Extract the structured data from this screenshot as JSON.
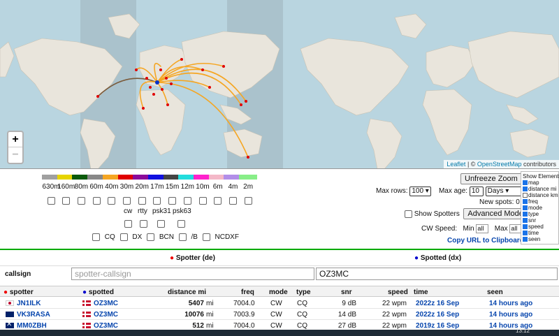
{
  "map": {
    "zoom_in": "+",
    "zoom_out": "−",
    "attribution_leaflet": "Leaflet",
    "attribution_sep": " | © ",
    "attribution_osm": "OpenStreetMap",
    "attribution_tail": " contributors"
  },
  "bands": [
    {
      "label": "630m",
      "color": "#a0a0a0"
    },
    {
      "label": "160m",
      "color": "#e6d400"
    },
    {
      "label": "80m",
      "color": "#0b5a0b"
    },
    {
      "label": "60m",
      "color": "#888888"
    },
    {
      "label": "40m",
      "color": "#f5a623"
    },
    {
      "label": "30m",
      "color": "#e00000"
    },
    {
      "label": "20m",
      "color": "#8b0a9a"
    },
    {
      "label": "17m",
      "color": "#1010e0"
    },
    {
      "label": "15m",
      "color": "#444444"
    },
    {
      "label": "12m",
      "color": "#22dddd"
    },
    {
      "label": "10m",
      "color": "#ff22cc"
    },
    {
      "label": "6m",
      "color": "#f4b8c8"
    },
    {
      "label": "4m",
      "color": "#b28ee8"
    },
    {
      "label": "2m",
      "color": "#88ee88"
    }
  ],
  "modes": [
    "cw",
    "rtty",
    "psk31",
    "psk63"
  ],
  "filters": [
    "CQ",
    "DX",
    "BCN",
    "/B",
    "NCDXF"
  ],
  "controls": {
    "unfreeze_label": "Unfreeze Zoom",
    "max_rows_label": "Max rows:",
    "max_rows_value": "100 ▾",
    "max_age_label": "Max age:",
    "max_age_value": "10",
    "max_age_unit": "Days ▾",
    "new_spots": "New spots: 0",
    "show_spotters": "Show Spotters",
    "advanced_mode": "Advanced Mode",
    "cw_speed_label": "CW Speed:",
    "min_label": "Min",
    "min_value": "all",
    "max_label": "Max",
    "max_value": "all",
    "copy_url": "Copy URL to Clipboard"
  },
  "show_elements": {
    "title": "Show Elements",
    "items": [
      {
        "label": "map",
        "checked": true
      },
      {
        "label": "distance mi",
        "checked": true
      },
      {
        "label": "distance km",
        "checked": false
      },
      {
        "label": "freq",
        "checked": true
      },
      {
        "label": "mode",
        "checked": true
      },
      {
        "label": "type",
        "checked": true
      },
      {
        "label": "snr",
        "checked": true
      },
      {
        "label": "speed",
        "checked": true
      },
      {
        "label": "time",
        "checked": true
      },
      {
        "label": "seen",
        "checked": true
      }
    ]
  },
  "section": {
    "spotter_de": "Spotter (de)",
    "spotted_dx": "Spotted (dx)",
    "callsign_label": "callsign",
    "spotter_placeholder": "spotter-callsign",
    "spotted_value": "OZ3MC"
  },
  "table": {
    "headers": {
      "spotter": "spotter",
      "spotted": "spotted",
      "distance": "distance mi",
      "freq": "freq",
      "mode": "mode",
      "type": "type",
      "snr": "snr",
      "speed": "speed",
      "time": "time",
      "seen": "seen"
    },
    "rows": [
      {
        "spotter": "JN1ILK",
        "spotter_flag": "jp",
        "spotted": "OZ3MC",
        "distance": "5407",
        "unit": "mi",
        "freq": "7004.0",
        "mode": "CW",
        "type": "CQ",
        "snr": "9 dB",
        "speed": "22 wpm",
        "time": "2022z 16 Sep",
        "seen": "14 hours ago"
      },
      {
        "spotter": "VK3RASA",
        "spotter_flag": "au",
        "spotted": "OZ3MC",
        "distance": "10076",
        "unit": "mi",
        "freq": "7003.9",
        "mode": "CW",
        "type": "CQ",
        "snr": "14 dB",
        "speed": "22 wpm",
        "time": "2022z 16 Sep",
        "seen": "14 hours ago"
      },
      {
        "spotter": "MM0ZBH",
        "spotter_flag": "gb",
        "spotted": "OZ3MC",
        "distance": "512",
        "unit": "mi",
        "freq": "7004.0",
        "mode": "CW",
        "type": "CQ",
        "snr": "27 dB",
        "speed": "22 wpm",
        "time": "2019z 16 Sep",
        "seen": "14 hours ago"
      }
    ]
  },
  "taskbar": {
    "time": "13:12"
  }
}
